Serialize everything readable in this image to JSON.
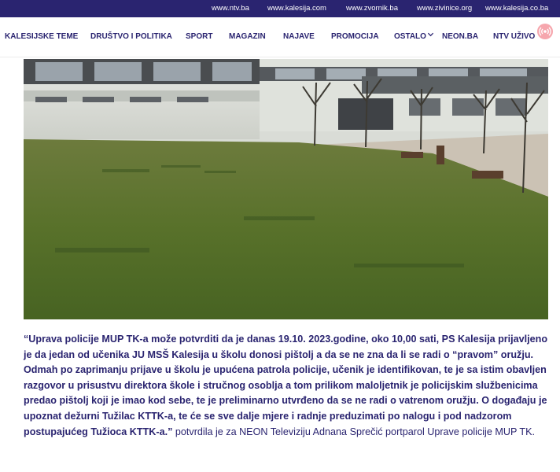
{
  "topbar": {
    "links": [
      "www.ntv.ba",
      "www.kalesija.com",
      "www.zvornik.ba",
      "www.zivinice.org",
      "www.kalesija.co.ba"
    ]
  },
  "nav": {
    "items": [
      "KALESIJSKE TEME",
      "DRUŠTVO I POLITIKA",
      "SPORT",
      "MAGAZIN",
      "NAJAVE",
      "PROMOCIJA",
      "OSTALO",
      "NEON.BA",
      "NTV UŽIVO"
    ],
    "dropdown_icon": "chevron-down-icon",
    "live_icon": "broadcast-icon"
  },
  "colors": {
    "brand": "#2a2470",
    "live_badge": "#f6a6ad"
  },
  "article": {
    "quote_open": "“",
    "quote_bold": "Uprava policije MUP TK-a može potvrditi da je danas 19.10. 2023.godine, oko 10,00 sati, PS Kalesija prijavljeno je da jedan od učenika JU MSŠ Kalesija u školu donosi pištolj a da se ne zna da li se radi o “pravom” oružju. Odmah po zaprimanju prijave u školu je upućena patrola policije, učenik je identifikovan, te je sa istim obavljen razgovor u prisustvu direktora škole i stručnog osoblja a tom prilikom maloljetnik je policijskim službenicima predao pištolj koji je imao kod sebe, te je preliminarno utvrđeno da se ne radi o vatrenom oružju. O događaju je upoznat dežurni Tužilac KTTK-a, te će se sve dalje mjere i radnje preduzimati po nalogu i pod nadzorom postupajućeg Tužioca KTTK-a.",
    "quote_close": "”",
    "attribution": " potvrdila je za NEON Televiziju Adnana Sprečić portparol Uprave policije MUP TK."
  }
}
